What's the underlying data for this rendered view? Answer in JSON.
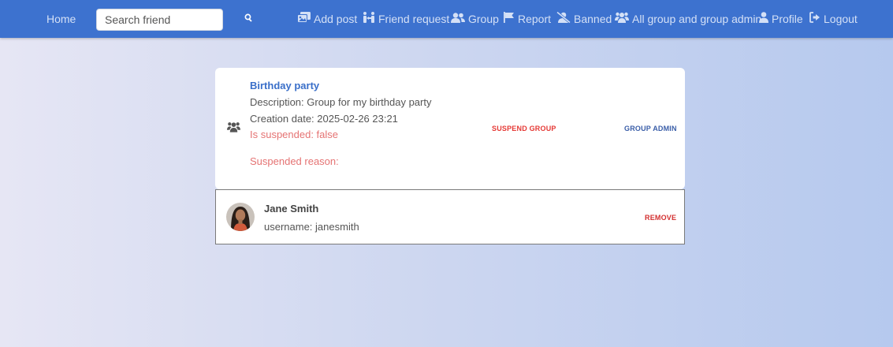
{
  "nav": {
    "home": "Home",
    "search_placeholder": "Search friend",
    "add_post": "Add post",
    "friend_request": "Friend request",
    "group": "Group",
    "report": "Report",
    "banned": "Banned",
    "all_group_admin": "All group and group admin",
    "profile": "Profile",
    "logout": "Logout"
  },
  "group": {
    "title": "Birthday party",
    "description": "Description: Group for my birthday party",
    "creation_date": "Creation date: 2025-02-26 23:21",
    "is_suspended": "Is suspended: false",
    "suspended_reason": "Suspended reason:",
    "suspend_label": "SUSPEND GROUP",
    "admin_label": "GROUP ADMIN",
    "colors": {
      "suspend": "#e53935",
      "admin": "#3a5ea8"
    }
  },
  "members": [
    {
      "name": "Jane Smith",
      "username": "username: janesmith",
      "remove_label": "REMOVE"
    }
  ],
  "icons": {
    "group": "users-icon",
    "search": "search-icon",
    "add_post": "images-icon",
    "friend_request": "people-arrows-icon",
    "group_nav": "user-group-icon",
    "report": "flag-icon",
    "banned": "user-slash-icon",
    "all_group": "users-icon",
    "profile": "user-icon",
    "logout": "sign-out-icon"
  },
  "theme": {
    "navbar": "#3d72cf",
    "link": "#d4e0f6",
    "accent": "#3a6fc9"
  }
}
